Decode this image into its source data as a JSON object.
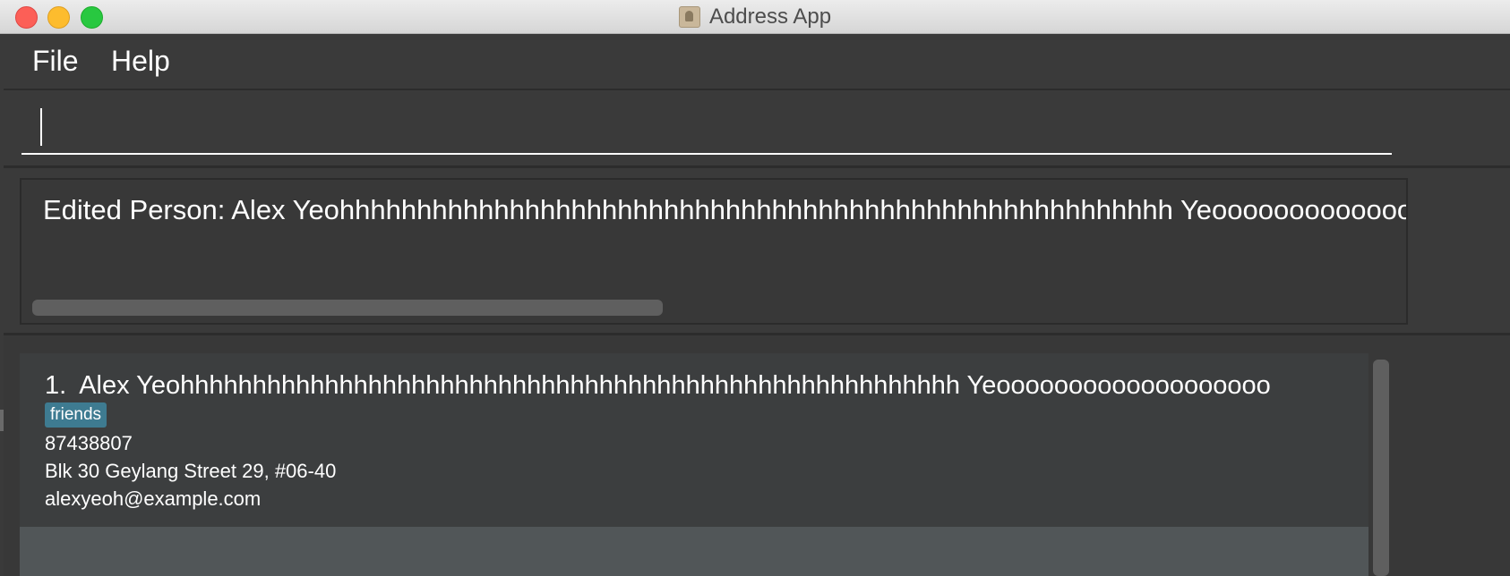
{
  "window": {
    "title": "Address App"
  },
  "menu": {
    "file_label": "File",
    "help_label": "Help"
  },
  "command": {
    "value": "",
    "placeholder": ""
  },
  "result": {
    "text": "Edited Person: Alex Yeohhhhhhhhhhhhhhhhhhhhhhhhhhhhhhhhhhhhhhhhhhhhhhhhhhhhhh Yeoooooooooooooooooooooooo"
  },
  "persons": [
    {
      "index": "1.",
      "name": "Alex Yeohhhhhhhhhhhhhhhhhhhhhhhhhhhhhhhhhhhhhhhhhhhhhhhhhhhhhh Yeooooooooooooooooooo",
      "tag": "friends",
      "phone": "87438807",
      "address": "Blk 30 Geylang Street 29, #06-40",
      "email": "alexyeoh@example.com"
    }
  ],
  "colors": {
    "background": "#3a3a3a",
    "tag_background": "#3e7b91",
    "text": "#ffffff"
  },
  "icons": {
    "app": "address-book-icon"
  }
}
